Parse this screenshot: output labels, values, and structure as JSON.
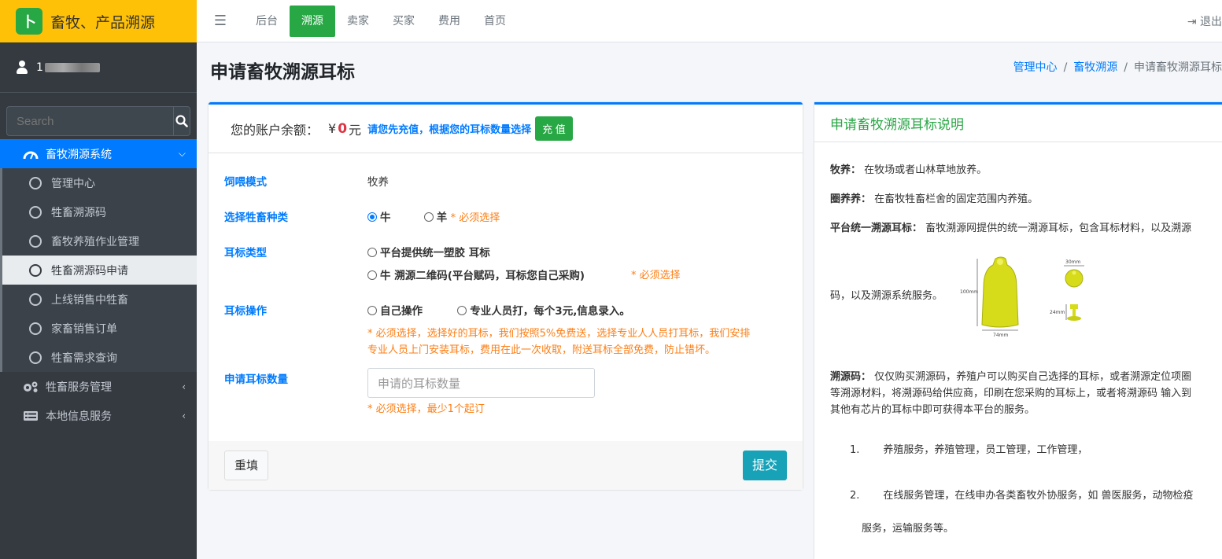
{
  "brand": {
    "logo_text": "卜",
    "title": "畜牧、产品溯源"
  },
  "user": {
    "name_prefix": "1"
  },
  "search": {
    "placeholder": "Search"
  },
  "sidebar": {
    "sections": [
      {
        "label": "畜牧溯源系统"
      },
      {
        "label": "牲畜服务管理"
      },
      {
        "label": "本地信息服务"
      }
    ],
    "items": [
      {
        "label": "管理中心"
      },
      {
        "label": "牲畜溯源码"
      },
      {
        "label": "畜牧养殖作业管理"
      },
      {
        "label": "牲畜溯源码申请"
      },
      {
        "label": "上线销售中牲畜"
      },
      {
        "label": "家畜销售订单"
      },
      {
        "label": "牲畜需求查询"
      }
    ]
  },
  "topnav": {
    "items": [
      {
        "label": "后台"
      },
      {
        "label": "溯源"
      },
      {
        "label": "卖家"
      },
      {
        "label": "买家"
      },
      {
        "label": "费用"
      },
      {
        "label": "首页"
      }
    ],
    "logout": "退出"
  },
  "page": {
    "title": "申请畜牧溯源耳标"
  },
  "breadcrumb": {
    "home": "管理中心",
    "section": "畜牧溯源",
    "current": "申请畜牧溯源耳标"
  },
  "balance": {
    "label": "您的账户余额：",
    "currency": "¥",
    "value": "0",
    "unit": "元",
    "tip": "请您先充值，根据您的耳标数量选择",
    "charge_button": "充 值"
  },
  "form": {
    "feeding": {
      "label": "饲喂模式",
      "value": "牧养"
    },
    "species": {
      "label": "选择牲畜种类",
      "option1": "牛",
      "option2": "羊",
      "required": "* 必须选择"
    },
    "tag_type": {
      "label": "耳标类型",
      "option1": "平台提供统一塑胶 耳标",
      "option2": "牛 溯源二维码(平台赋码，耳标您自己采购)",
      "required": "* 必须选择"
    },
    "operation": {
      "label": "耳标操作",
      "option1": "自己操作",
      "option2": "专业人员打，每个3元,信息录入。",
      "note1": "* 必须选择，选择好的耳标，我们按照5%免费送，选择专业人人员打耳标，我们安排",
      "note2": "专业人员上门安装耳标，费用在此一次收取，附送耳标全部免费，防止错坏。"
    },
    "quantity": {
      "label": "申请耳标数量",
      "placeholder": "申请的耳标数量",
      "required": "* 必须选择，最少1个起订"
    },
    "reset_button": "重填",
    "submit_button": "提交"
  },
  "info": {
    "title": "申请畜牧溯源耳标说明",
    "grazing_term": "牧养：",
    "grazing_text": "在牧场或者山林草地放养。",
    "pen_term": "圈养养：",
    "pen_text": "在畜牧牲畜栏舍的固定范围内养殖。",
    "platform_term": "平台统一溯源耳标：",
    "platform_text": "畜牧溯源网提供的统一溯源耳标，包含耳标材料，以及溯源",
    "platform_text2": "码，以及溯源系统服务。",
    "figure_labels": {
      "height": "100mm",
      "width": "74mm",
      "dia": "30mm",
      "pin": "24mm"
    },
    "code_term": "溯源码：",
    "code_text1": "仅仅购买溯源码，养殖户可以购买自己选择的耳标，或者溯源定位项圈",
    "code_text2": "等溯源材料，将溯源码给供应商，印刷在您采购的耳标上，或者将溯源码 输入到",
    "code_text3": "其他有芯片的耳标中即可获得本平台的服务。",
    "list1_num": "1.",
    "list1_text": "养殖服务，养殖管理，员工管理，工作管理，",
    "list2_num": "2.",
    "list2_text": "在线服务管理，在线申办各类畜牧外协服务，如 兽医服务，动物检疫",
    "list2_text2": "服务，运输服务等。"
  },
  "colors": {
    "brand": "#ffc107",
    "primary": "#007bff",
    "success": "#28a745",
    "info": "#17a2b8",
    "warning": "#fd7e14",
    "danger": "#dc3545",
    "sidebar": "#343a40"
  }
}
